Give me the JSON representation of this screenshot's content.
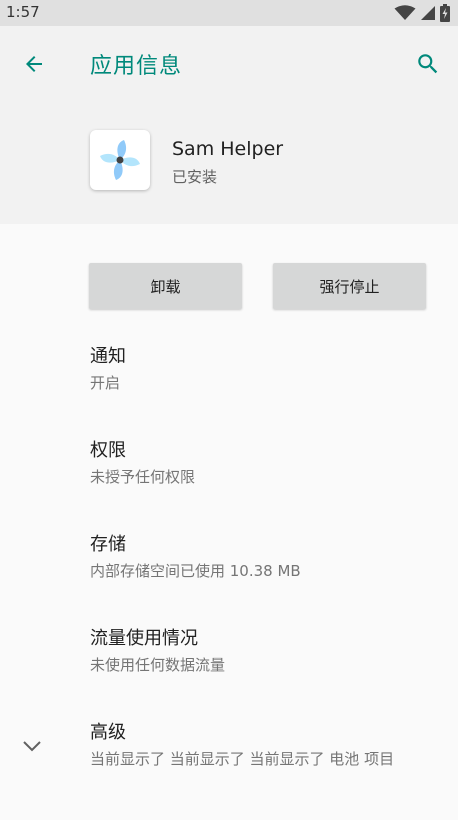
{
  "status_bar": {
    "time": "1:57"
  },
  "header": {
    "title": "应用信息",
    "back_icon": "arrow-back-icon",
    "search_icon": "search-icon"
  },
  "app": {
    "name": "Sam Helper",
    "status": "已安装",
    "icon": "pinwheel-icon"
  },
  "buttons": {
    "uninstall": "卸载",
    "force_stop": "强行停止"
  },
  "items": [
    {
      "title": "通知",
      "summary": "开启"
    },
    {
      "title": "权限",
      "summary": "未授予任何权限"
    },
    {
      "title": "存储",
      "summary": "内部存储空间已使用 10.38 MB"
    },
    {
      "title": "流量使用情况",
      "summary": "未使用任何数据流量"
    },
    {
      "title": "高级",
      "summary": "当前显示了 当前显示了 当前显示了 电池 项目"
    }
  ],
  "colors": {
    "accent": "#00897b",
    "header_bg": "#f2f2f2",
    "button_bg": "#d6d7d7"
  }
}
